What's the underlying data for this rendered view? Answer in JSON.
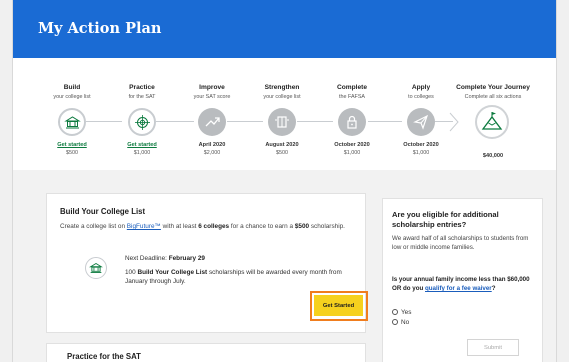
{
  "header": {
    "title": "My Action Plan"
  },
  "journey": {
    "steps": [
      {
        "title": "Build",
        "sub": "your college list",
        "label": "Get started",
        "value": "$500",
        "state": "active",
        "icon": "college-list-icon"
      },
      {
        "title": "Practice",
        "sub": "for the SAT",
        "label": "Get started",
        "value": "$1,000",
        "state": "active",
        "icon": "target-icon"
      },
      {
        "title": "Improve",
        "sub": "your SAT score",
        "label": "April 2020",
        "value": "$2,000",
        "state": "inactive",
        "icon": "trend-up-icon"
      },
      {
        "title": "Strengthen",
        "sub": "your college list",
        "label": "August 2020",
        "value": "$500",
        "state": "inactive",
        "icon": "book-icon"
      },
      {
        "title": "Complete",
        "sub": "the FAFSA",
        "label": "October 2020",
        "value": "$1,000",
        "state": "inactive",
        "icon": "lock-icon"
      },
      {
        "title": "Apply",
        "sub": "to colleges",
        "label": "October 2020",
        "value": "$1,000",
        "state": "inactive",
        "icon": "paper-plane-icon"
      },
      {
        "title": "Complete Your Journey",
        "sub": "Complete all six actions",
        "label": "$40,000",
        "value": "",
        "state": "final",
        "icon": "mountain-flag-icon"
      }
    ]
  },
  "college_card": {
    "title": "Build Your College List",
    "desc_pre": "Create a college list on ",
    "desc_link": "BigFuture™",
    "desc_mid": " with at least ",
    "desc_bold1": "6 colleges",
    "desc_mid2": " for a chance to earn a ",
    "desc_bold2": "$500",
    "desc_post": " scholarship.",
    "deadline_label": "Next Deadline: ",
    "deadline_value": "February 29",
    "note_pre": "100 ",
    "note_bold": "Build Your College List",
    "note_post": " scholarships will be awarded every month from January through July.",
    "button_label": "Get Started"
  },
  "practice_card": {
    "title": "Practice for the SAT"
  },
  "eligibility": {
    "title": "Are you eligible for additional scholarship entries?",
    "desc": "We award half of all scholarships to students from low or middle income families.",
    "question_pre": "Is your annual family income less than $60,000 OR do you ",
    "question_link": "qualify for a fee waiver",
    "question_post": "?",
    "options": [
      "Yes",
      "No"
    ],
    "submit_label": "Submit"
  },
  "colors": {
    "header_blue": "#1a6bd4",
    "cta_yellow": "#f6d11e",
    "highlight_orange": "#f07d1e",
    "link_green": "#0b7a3e"
  }
}
